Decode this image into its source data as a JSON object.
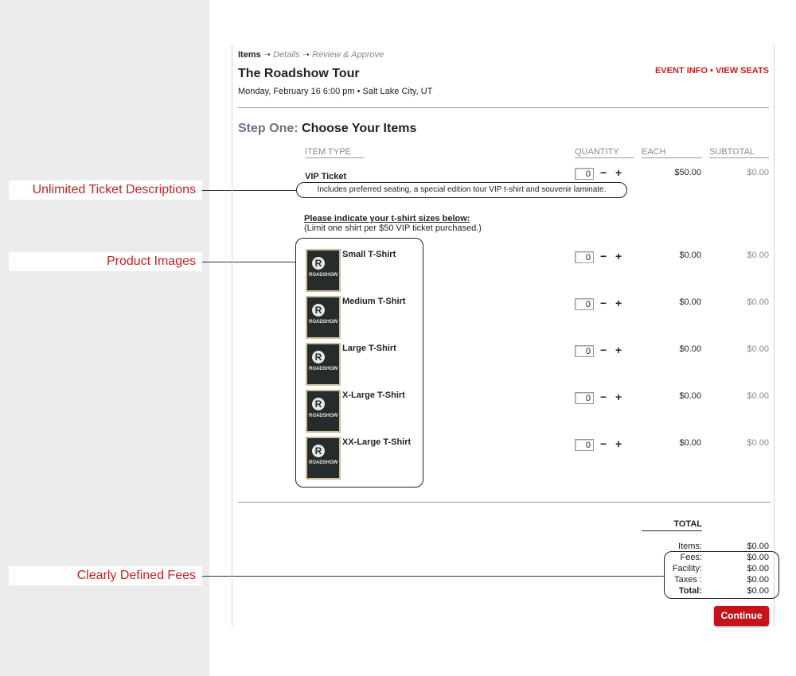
{
  "breadcrumb": {
    "current": "Items",
    "arrow": "➝",
    "step2": "Details",
    "step3": "Review & Approve"
  },
  "event": {
    "title": "The Roadshow Tour",
    "date_time": "Monday, February 16  6:00 pm",
    "separator": "•",
    "location": "Salt Lake City, UT"
  },
  "top_links": {
    "event_info": "EVENT INFO",
    "separator": "•",
    "view_seats": "VIEW SEATS"
  },
  "step": {
    "prefix": "Step One:",
    "title": "Choose Your Items"
  },
  "columns": {
    "item_type": "ITEM TYPE",
    "quantity": "QUANTITY",
    "each": "EACH",
    "subtotal": "SUBTOTAL"
  },
  "vip": {
    "name": "VIP Ticket",
    "description": "Includes preferred seating, a special edition tour VIP t-shirt and souvenir laminate.",
    "qty": "0",
    "each": "$50.00",
    "subtotal": "$0.00"
  },
  "stepper": {
    "minus": "−",
    "plus": "+"
  },
  "sizes_note": {
    "heading": "Please indicate your t-shirt sizes below:",
    "subtext": "(Limit one shirt per $50 VIP ticket purchased.)"
  },
  "shirts": [
    {
      "name": "Small T-Shirt",
      "qty": "0",
      "each": "$0.00",
      "subtotal": "$0.00"
    },
    {
      "name": "Medium T-Shirt",
      "qty": "0",
      "each": "$0.00",
      "subtotal": "$0.00"
    },
    {
      "name": "Large T-Shirt",
      "qty": "0",
      "each": "$0.00",
      "subtotal": "$0.00"
    },
    {
      "name": "X-Large T-Shirt",
      "qty": "0",
      "each": "$0.00",
      "subtotal": "$0.00"
    },
    {
      "name": "XX-Large T-Shirt",
      "qty": "0",
      "each": "$0.00",
      "subtotal": "$0.00"
    }
  ],
  "shirt_image": {
    "logo_letter": "R",
    "wordmark": "ROADSHOW"
  },
  "totals": {
    "heading": "TOTAL",
    "items_label": "Items:",
    "items_value": "$0.00",
    "fees_label": "Fees:",
    "fees_value": "$0.00",
    "facility_label": "Facility:",
    "facility_value": "$0.00",
    "taxes_label": "Taxes :",
    "taxes_value": "$0.00",
    "total_label": "Total:",
    "total_value": "$0.00"
  },
  "continue_label": "Continue",
  "callouts": {
    "descriptions": "Unlimited Ticket Descriptions",
    "images": "Product Images",
    "fees": "Clearly Defined Fees"
  },
  "colors": {
    "accent": "#c8201f",
    "button": "#c4141a",
    "step_prefix": "#6f7285",
    "sidebar": "#ececec"
  }
}
